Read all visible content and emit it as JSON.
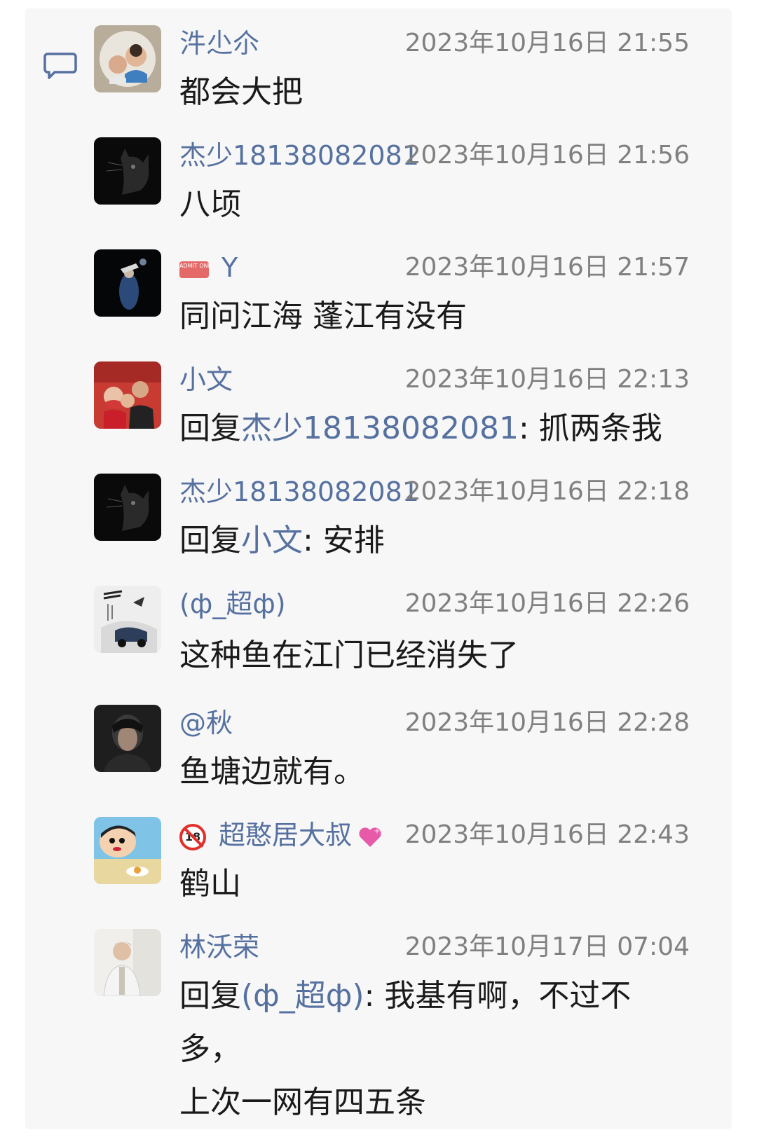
{
  "comments": [
    {
      "name": "汼尐尒",
      "time": "2023年10月16日 21:55",
      "text": "都会大把"
    },
    {
      "name": "杰少18138082081",
      "time": "2023年10月16日 21:56",
      "text": "八顷"
    },
    {
      "name": "Y",
      "time": "2023年10月16日 21:57",
      "text": "同问江海 蓬江有没有",
      "badge": "ADMIT ONE"
    },
    {
      "name": "小文",
      "time": "2023年10月16日 22:13",
      "reply_prefix": "回复",
      "reply_to": "杰少18138082081",
      "text": ": 抓两条我"
    },
    {
      "name": "杰少18138082081",
      "time": "2023年10月16日 22:18",
      "reply_prefix": "回复",
      "reply_to": "小文",
      "text": ": 安排"
    },
    {
      "name": "(ф_超ф)",
      "time": "2023年10月16日 22:26",
      "text": "这种鱼在江门已经消失了"
    },
    {
      "name": "@秋",
      "time": "2023年10月16日 22:28",
      "text": "鱼塘边就有。"
    },
    {
      "name": "超憨居大叔",
      "time": "2023年10月16日 22:43",
      "text": "鹤山"
    },
    {
      "name": "林沃荣",
      "time": "2023年10月17日 07:04",
      "reply_prefix": "回复",
      "reply_to": "(ф_超ф)",
      "text": ": 我基有啊，不过不多，",
      "text_line2": "上次一网有四五条"
    }
  ],
  "icons": {
    "comment": "comment-bubble-icon",
    "ticket": "ticket-icon",
    "no18": "no-under-18-icon",
    "heart": "sparkling-heart-icon"
  },
  "colors": {
    "name": "#56719f",
    "time": "#808080",
    "text": "#1a1a1a",
    "panel": "#f7f7f8"
  }
}
